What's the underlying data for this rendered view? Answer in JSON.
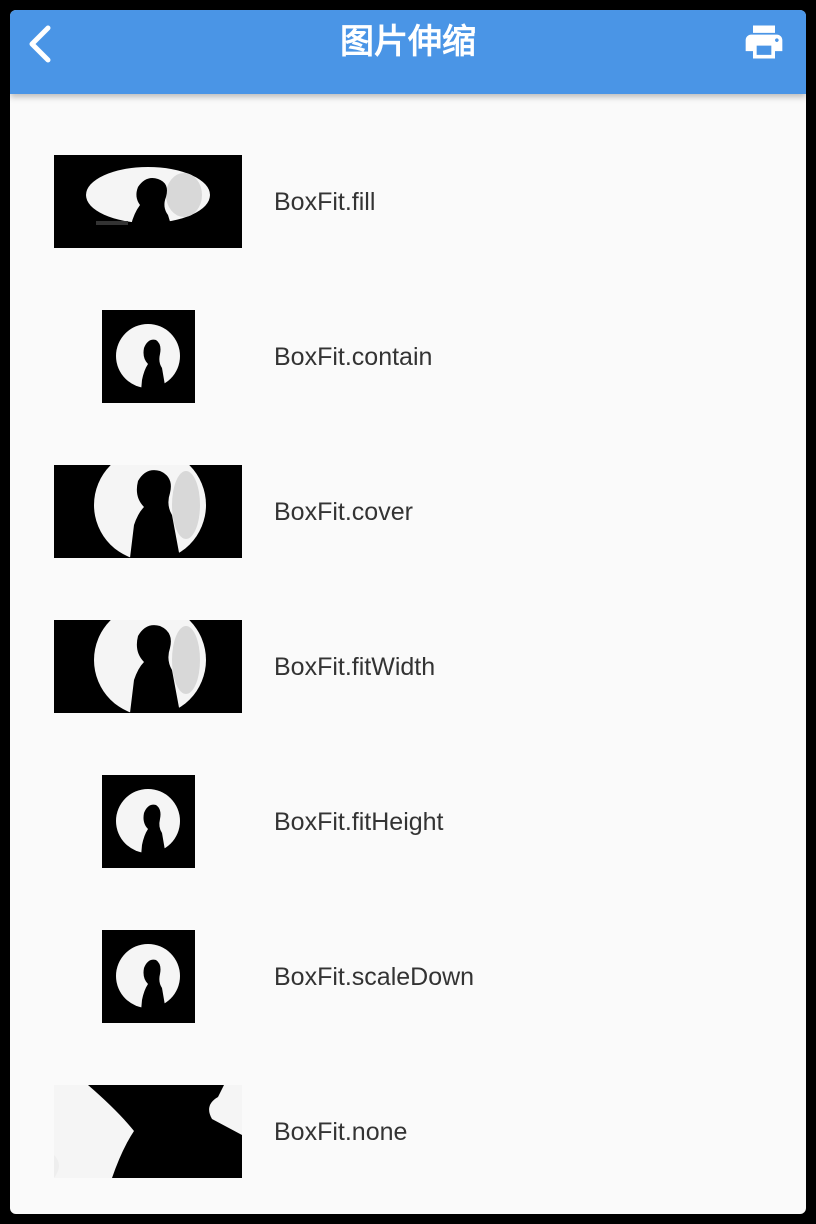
{
  "appbar": {
    "title": "图片伸缩",
    "back_icon": "chevron-left-icon",
    "print_icon": "printer-icon",
    "color": "#4a95e6"
  },
  "items": [
    {
      "label": "BoxFit.fill",
      "thumb": "wide"
    },
    {
      "label": "BoxFit.contain",
      "thumb": "square"
    },
    {
      "label": "BoxFit.cover",
      "thumb": "wide-crop"
    },
    {
      "label": "BoxFit.fitWidth",
      "thumb": "wide-crop"
    },
    {
      "label": "BoxFit.fitHeight",
      "thumb": "square"
    },
    {
      "label": "BoxFit.scaleDown",
      "thumb": "square"
    },
    {
      "label": "BoxFit.none",
      "thumb": "zoom"
    }
  ]
}
